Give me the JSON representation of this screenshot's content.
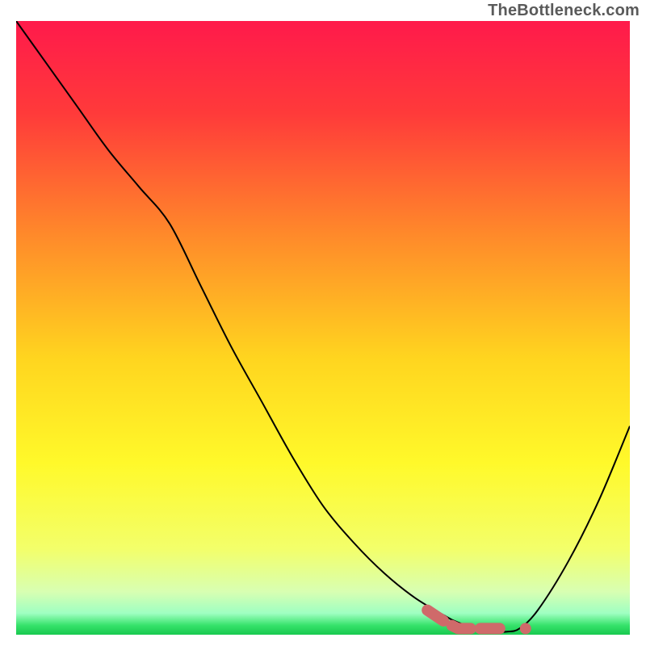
{
  "watermark": "TheBottleneck.com",
  "chart_data": {
    "type": "line",
    "title": "",
    "xlabel": "",
    "ylabel": "",
    "xlim": [
      0,
      100
    ],
    "ylim": [
      0,
      100
    ],
    "grid": false,
    "legend": false,
    "series": [
      {
        "name": "curve",
        "color": "#000000",
        "x": [
          0,
          5,
          10,
          15,
          20,
          25,
          30,
          35,
          40,
          45,
          50,
          55,
          60,
          65,
          70,
          72,
          75,
          78,
          80,
          82,
          85,
          90,
          95,
          100
        ],
        "y": [
          100,
          93,
          86,
          79,
          73,
          67,
          57,
          47,
          38,
          29,
          21,
          15,
          10,
          6,
          3,
          2,
          1,
          0.5,
          0.5,
          1,
          4,
          12,
          22,
          34
        ]
      }
    ],
    "highlight_segment": {
      "name": "optimal-range",
      "color": "#cf6a6a",
      "stroke_width": 14,
      "x": [
        67,
        70,
        72,
        74,
        76,
        78,
        80
      ],
      "y": [
        4,
        2,
        1,
        1,
        1,
        1,
        1
      ]
    },
    "highlight_dot": {
      "name": "optimal-point",
      "color": "#cf6a6a",
      "radius": 7,
      "x": 83,
      "y": 1
    },
    "gradient_stops": [
      {
        "offset": 0.0,
        "color": "#ff1a4b"
      },
      {
        "offset": 0.15,
        "color": "#ff3a3a"
      },
      {
        "offset": 0.35,
        "color": "#ff8a2a"
      },
      {
        "offset": 0.55,
        "color": "#ffd51f"
      },
      {
        "offset": 0.72,
        "color": "#fff92a"
      },
      {
        "offset": 0.86,
        "color": "#f3ff6a"
      },
      {
        "offset": 0.93,
        "color": "#d8ffb2"
      },
      {
        "offset": 0.965,
        "color": "#9fffc2"
      },
      {
        "offset": 0.985,
        "color": "#35e26a"
      },
      {
        "offset": 1.0,
        "color": "#18c84f"
      }
    ]
  }
}
